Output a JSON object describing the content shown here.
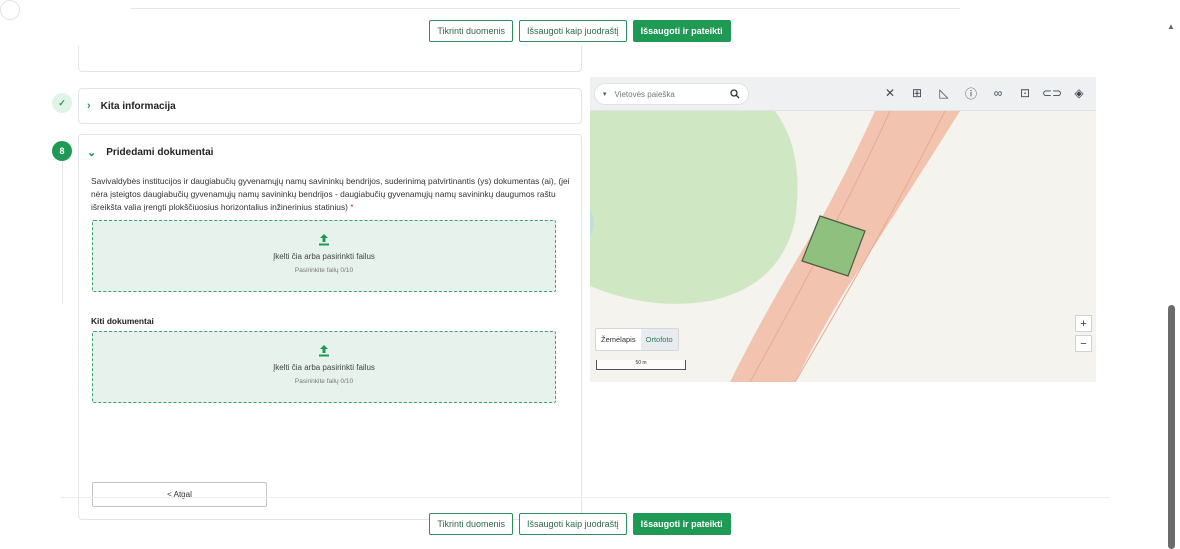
{
  "actions": {
    "check_label": "Tikrinti duomenis",
    "draft_label": "Išsaugoti kaip juodraštį",
    "submit_label": "Išsaugoti ir pateikti"
  },
  "steps": {
    "kita": {
      "title": "Kita informacija"
    },
    "docs": {
      "number": "8",
      "title": "Pridedami dokumentai",
      "description": "Savivaldybės institucijos ir daugiabučių gyvenamųjų namų savininkų bendrijos, suderinimą patvirtinantis (ys) dokumentas (ai), (jei nėra įsteigtos daugiabučių gyvenamųjų namų savininkų bendrijos - daugiabučių gyvenamųjų namų savininkų daugumos raštu išreikšta valia įrengti plokščiuosius horizontalius inžinerinius statinius)",
      "required_mark": "*",
      "upload_main": "Įkelti čia arba pasirinkti failus",
      "upload_sub": "Pasirinkite failų 0/10",
      "other_docs_label": "Kiti dokumentai",
      "back_label": "< Atgal"
    }
  },
  "map": {
    "search_placeholder": "Vietovės paieška",
    "tools": [
      "expand-icon",
      "import-icon",
      "measure-icon",
      "info-icon",
      "link-icon",
      "export-icon",
      "chain-icon",
      "layers-icon"
    ],
    "base_tabs": [
      "Žemėlapis",
      "Ortofoto"
    ],
    "active_tab": "Ortofoto",
    "scale_label": "50 m",
    "zoom_in": "+",
    "zoom_out": "−"
  },
  "colors": {
    "primary": "#1f9a55",
    "dropzone_bg": "#e7f2ec",
    "map_green": "#cfe8c3",
    "road": "#f2c4b0",
    "parcel": "#8fc07e"
  }
}
